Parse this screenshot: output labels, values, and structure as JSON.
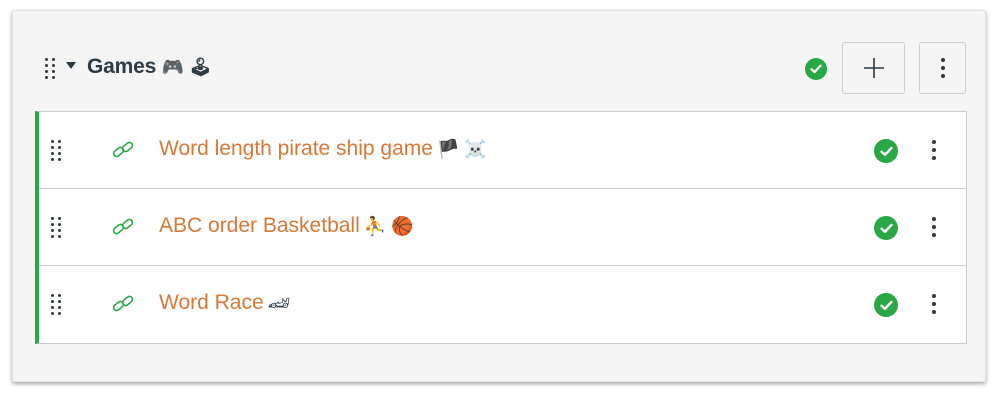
{
  "module": {
    "title": "Games",
    "title_emoji": "🎮 🕹",
    "published": true,
    "add_button_icon": "plus-icon",
    "admin_button_icon": "kebab-menu-icon"
  },
  "items": [
    {
      "title": "Word length pirate ship game",
      "emoji": "🏴 ☠️",
      "type_icon": "link-icon",
      "published": true
    },
    {
      "title": "ABC order Basketball",
      "emoji": "⛹ 🏀",
      "type_icon": "link-icon",
      "published": true
    },
    {
      "title": "Word Race",
      "emoji": "🏎",
      "type_icon": "link-icon",
      "published": true
    }
  ],
  "colors": {
    "accent_green": "#2aa845",
    "link_orange": "#d97836",
    "text_dark": "#2d3b45"
  }
}
